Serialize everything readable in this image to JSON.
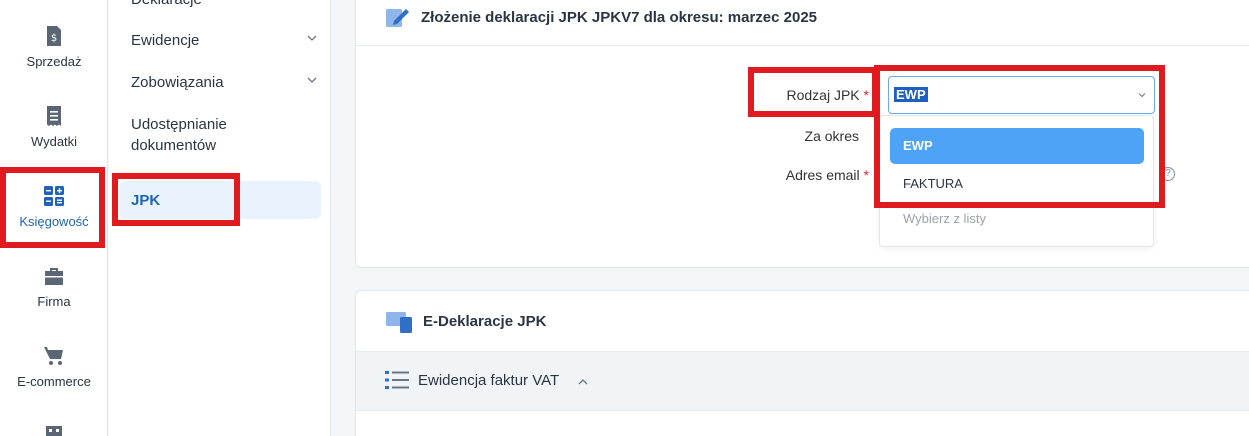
{
  "rail": {
    "items": [
      {
        "label": "Sprzedaż",
        "icon": "invoice-dollar-icon"
      },
      {
        "label": "Wydatki",
        "icon": "receipt-icon"
      },
      {
        "label": "Księgowość",
        "icon": "calculator-icon"
      },
      {
        "label": "Firma",
        "icon": "briefcase-icon"
      },
      {
        "label": "E-commerce",
        "icon": "cart-icon"
      }
    ]
  },
  "submenu": {
    "items": [
      {
        "label": "Deklaracje"
      },
      {
        "label": "Ewidencje"
      },
      {
        "label": "Zobowiązania"
      },
      {
        "label": "Udostępnianie dokumentów"
      },
      {
        "label": "JPK"
      }
    ]
  },
  "form_card": {
    "title": "Złożenie deklaracji JPK JPKV7 dla okresu: marzec 2025",
    "rodzaj_label": "Rodzaj JPK",
    "okres_label": "Za okres",
    "email_label": "Adres email",
    "required_mark": "*",
    "select_value": "EWP",
    "dropdown": {
      "options": [
        "EWP",
        "FAKTURA"
      ],
      "placeholder": "Wybierz z listy"
    },
    "help_glyph": "?"
  },
  "edekl_card": {
    "title": "E-Deklaracje JPK",
    "section_title": "Ewidencja faktur VAT"
  },
  "colors": {
    "accent": "#1e63b5",
    "highlight": "#e01b1f",
    "selected_option": "#4da3f5"
  }
}
